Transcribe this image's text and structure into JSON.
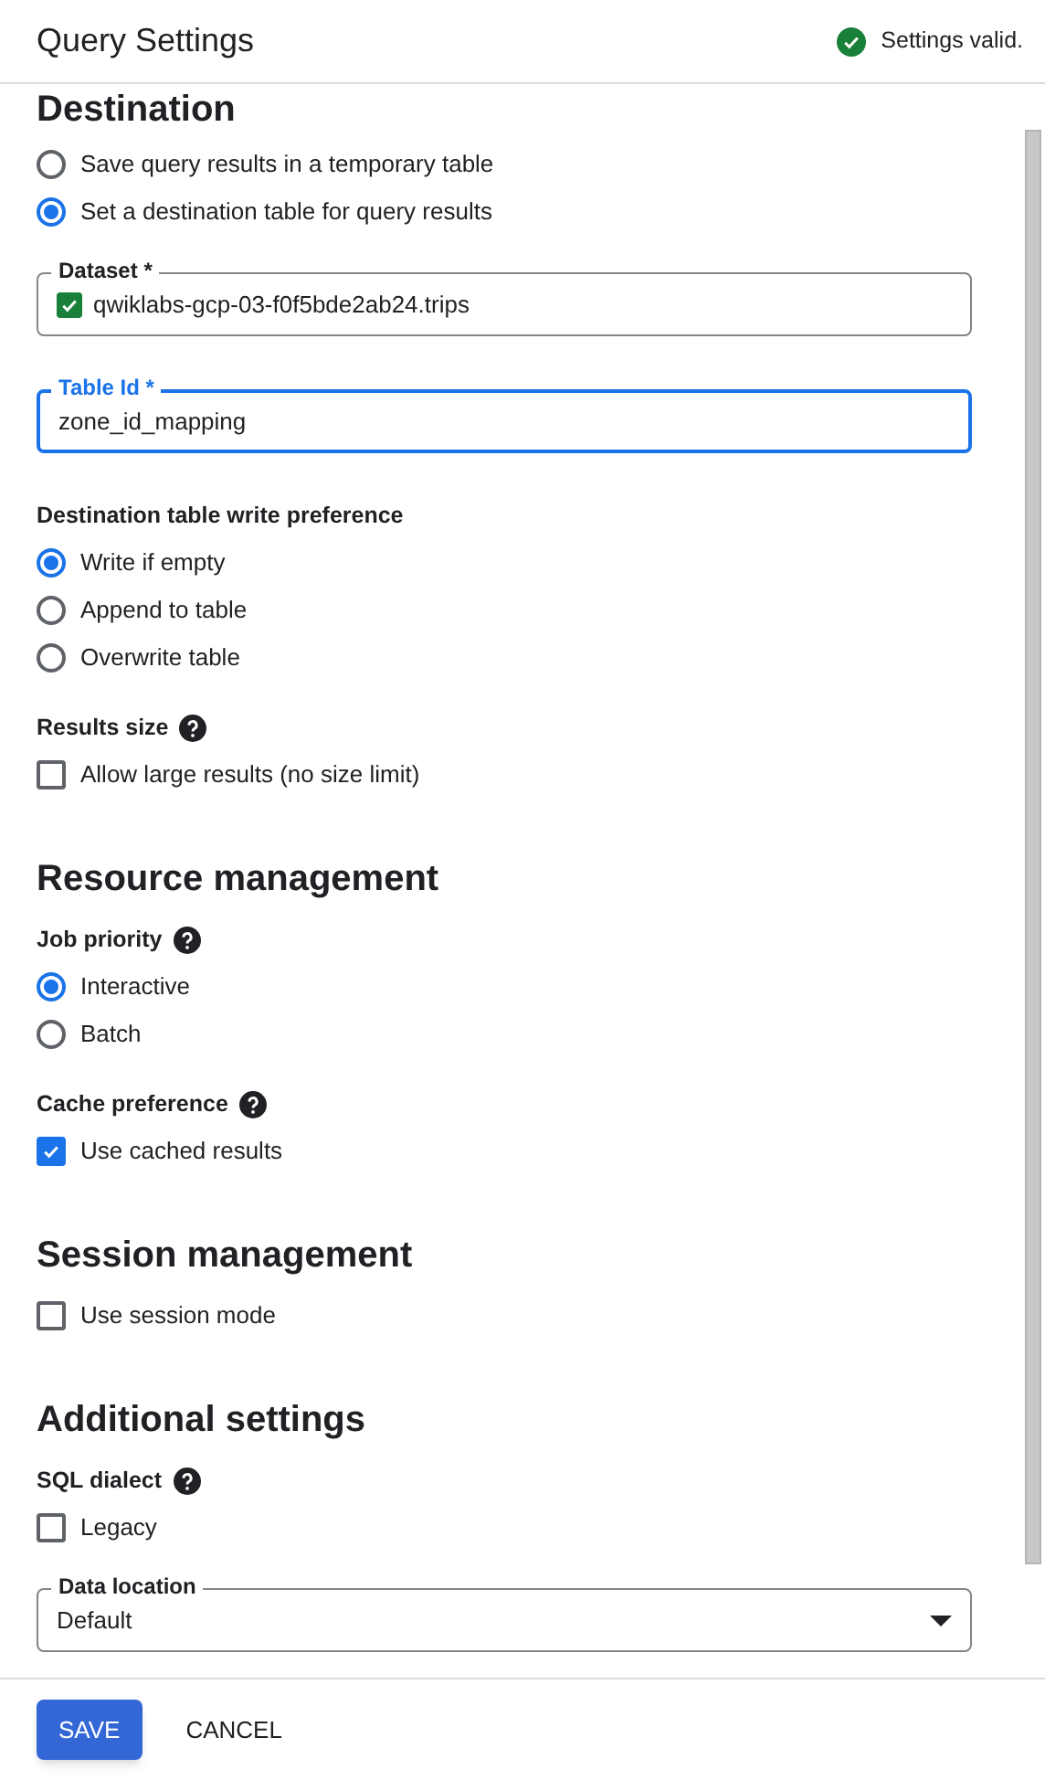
{
  "header": {
    "title": "Query Settings",
    "status": {
      "text": "Settings valid.",
      "valid": true
    }
  },
  "sections": [
    {
      "title": "Destination",
      "items": [
        {
          "kind": "radio",
          "label": "Save query results in a temporary table",
          "selected": false
        },
        {
          "kind": "radio",
          "label": "Set a destination table for query results",
          "selected": true
        },
        {
          "kind": "field",
          "label": "Dataset *",
          "value": "qwiklabs-gcp-03-f0f5bde2ab24.trips",
          "verified": true,
          "focused": false
        },
        {
          "kind": "field",
          "label": "Table Id *",
          "value": "zone_id_mapping",
          "verified": false,
          "focused": true
        },
        {
          "kind": "label",
          "text": "Destination table write preference",
          "help": false
        },
        {
          "kind": "radio",
          "label": "Write if empty",
          "selected": true
        },
        {
          "kind": "radio",
          "label": "Append to table",
          "selected": false
        },
        {
          "kind": "radio",
          "label": "Overwrite table",
          "selected": false
        },
        {
          "kind": "label",
          "text": "Results size",
          "help": true
        },
        {
          "kind": "checkbox",
          "label": "Allow large results (no size limit)",
          "checked": false
        }
      ]
    },
    {
      "title": "Resource management",
      "items": [
        {
          "kind": "label",
          "text": "Job priority",
          "help": true
        },
        {
          "kind": "radio",
          "label": "Interactive",
          "selected": true
        },
        {
          "kind": "radio",
          "label": "Batch",
          "selected": false
        },
        {
          "kind": "label",
          "text": "Cache preference",
          "help": true
        },
        {
          "kind": "checkbox",
          "label": "Use cached results",
          "checked": true
        }
      ]
    },
    {
      "title": "Session management",
      "items": [
        {
          "kind": "checkbox",
          "label": "Use session mode",
          "checked": false
        }
      ]
    },
    {
      "title": "Additional settings",
      "items": [
        {
          "kind": "label",
          "text": "SQL dialect",
          "help": true
        },
        {
          "kind": "checkbox",
          "label": "Legacy",
          "checked": false
        },
        {
          "kind": "select",
          "label": "Data location",
          "value": "Default"
        }
      ]
    }
  ],
  "footer": {
    "buttons": [
      {
        "kind": "primary",
        "label": "SAVE"
      },
      {
        "kind": "text",
        "label": "CANCEL"
      }
    ]
  }
}
